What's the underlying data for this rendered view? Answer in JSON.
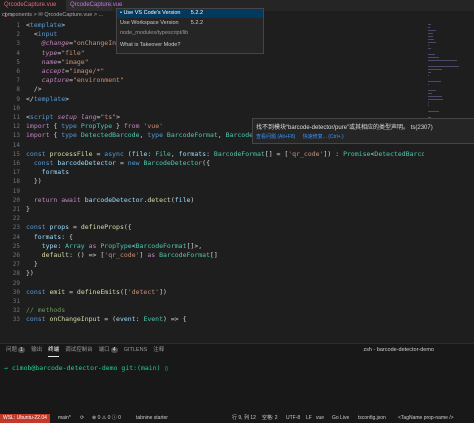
{
  "tabs": [
    {
      "label": "QrcodeCapture.vue 1",
      "close": "×"
    },
    {
      "label": "QrcodeCapture.vue"
    }
  ],
  "breadcrumb": "components > ✉ QrcodeCapture.vue > ...",
  "dropdown": {
    "items": [
      {
        "label": "• Use VS Code's Version",
        "version": "5.2.2"
      },
      {
        "label": "Use Workspace Version",
        "version": "5.2.2"
      },
      {
        "label": "node_modules/typescript/lib",
        "version": ""
      },
      {
        "label": "What is Takeover Mode?",
        "version": ""
      }
    ]
  },
  "code": [
    {
      "n": "1",
      "segs": [
        [
          "p",
          "<"
        ],
        [
          "tag",
          "template"
        ],
        [
          "p",
          ">"
        ]
      ]
    },
    {
      "n": "2",
      "segs": [
        [
          "p",
          "  <"
        ],
        [
          "tag",
          "input"
        ]
      ]
    },
    {
      "n": "3",
      "segs": [
        [
          "p",
          "    "
        ],
        [
          "attr",
          "@change"
        ],
        [
          "p",
          "="
        ],
        [
          "s",
          "\"onChangeInput\""
        ]
      ]
    },
    {
      "n": "4",
      "segs": [
        [
          "p",
          "    "
        ],
        [
          "attr",
          "type"
        ],
        [
          "p",
          "="
        ],
        [
          "s",
          "\"file\""
        ]
      ]
    },
    {
      "n": "5",
      "segs": [
        [
          "p",
          "    "
        ],
        [
          "attr",
          "name"
        ],
        [
          "p",
          "="
        ],
        [
          "s",
          "\"image\""
        ]
      ]
    },
    {
      "n": "6",
      "segs": [
        [
          "p",
          "    "
        ],
        [
          "attr",
          "accept"
        ],
        [
          "p",
          "="
        ],
        [
          "s",
          "\"image/*\""
        ]
      ]
    },
    {
      "n": "7",
      "segs": [
        [
          "p",
          "    "
        ],
        [
          "attr",
          "capture"
        ],
        [
          "p",
          "="
        ],
        [
          "s",
          "\"environment\""
        ]
      ]
    },
    {
      "n": "8",
      "segs": [
        [
          "p",
          "  />"
        ]
      ]
    },
    {
      "n": "9",
      "segs": [
        [
          "p",
          "</"
        ],
        [
          "tag",
          "template"
        ],
        [
          "p",
          ">"
        ]
      ]
    },
    {
      "n": "10",
      "segs": [
        [
          "p",
          ""
        ]
      ]
    },
    {
      "n": "11",
      "segs": [
        [
          "p",
          "<"
        ],
        [
          "tag",
          "script"
        ],
        [
          "p",
          " "
        ],
        [
          "attr",
          "setup"
        ],
        [
          "p",
          " "
        ],
        [
          "attr",
          "lang"
        ],
        [
          "p",
          "="
        ],
        [
          "s",
          "\"ts\""
        ],
        [
          "p",
          ">"
        ]
      ]
    },
    {
      "n": "12",
      "segs": [
        [
          "kw",
          "import"
        ],
        [
          "p",
          " { "
        ],
        [
          "k",
          "type"
        ],
        [
          "p",
          " "
        ],
        [
          "t",
          "PropType"
        ],
        [
          "p",
          " } "
        ],
        [
          "kw",
          "from"
        ],
        [
          "p",
          " "
        ],
        [
          "s",
          "'vue'"
        ]
      ]
    },
    {
      "n": "13",
      "segs": [
        [
          "kw",
          "import"
        ],
        [
          "p",
          " { "
        ],
        [
          "k",
          "type"
        ],
        [
          "p",
          " "
        ],
        [
          "t",
          "DetectedBarcode"
        ],
        [
          "p",
          ", "
        ],
        [
          "k",
          "type"
        ],
        [
          "p",
          " "
        ],
        [
          "t",
          "BarcodeFormat"
        ],
        [
          "p",
          ", "
        ],
        [
          "t",
          "BarcodeDetector"
        ],
        [
          "p",
          " } "
        ],
        [
          "kw",
          "from"
        ],
        [
          "p",
          " "
        ],
        [
          "s",
          "'barcode-detector/pure'"
        ]
      ]
    },
    {
      "n": "14",
      "segs": [
        [
          "p",
          ""
        ]
      ]
    },
    {
      "n": "15",
      "segs": [
        [
          "k",
          "const"
        ],
        [
          "p",
          " "
        ],
        [
          "f",
          "processFile"
        ],
        [
          "p",
          " = "
        ],
        [
          "k",
          "async"
        ],
        [
          "p",
          " ("
        ],
        [
          "v",
          "file"
        ],
        [
          "p",
          ": "
        ],
        [
          "t",
          "File"
        ],
        [
          "p",
          ", "
        ],
        [
          "v",
          "formats"
        ],
        [
          "p",
          ": "
        ],
        [
          "t",
          "BarcodeFormat"
        ],
        [
          "p",
          "[] = ["
        ],
        [
          "s",
          "'qr_code'"
        ],
        [
          "p",
          "]) : "
        ],
        [
          "t",
          "Promise"
        ],
        [
          "p",
          "<"
        ],
        [
          "t",
          "DetectedBarcode"
        ]
      ]
    },
    {
      "n": "16",
      "segs": [
        [
          "p",
          "  "
        ],
        [
          "k",
          "const"
        ],
        [
          "p",
          " "
        ],
        [
          "v",
          "barcodeDetector"
        ],
        [
          "p",
          " = "
        ],
        [
          "k",
          "new"
        ],
        [
          "p",
          " "
        ],
        [
          "t",
          "BarcodeDetector"
        ],
        [
          "p",
          "({"
        ]
      ]
    },
    {
      "n": "17",
      "segs": [
        [
          "p",
          "    "
        ],
        [
          "v",
          "formats"
        ]
      ]
    },
    {
      "n": "18",
      "segs": [
        [
          "p",
          "  })"
        ]
      ]
    },
    {
      "n": "19",
      "segs": [
        [
          "p",
          ""
        ]
      ]
    },
    {
      "n": "20",
      "segs": [
        [
          "p",
          "  "
        ],
        [
          "kw",
          "return"
        ],
        [
          "p",
          " "
        ],
        [
          "kw",
          "await"
        ],
        [
          "p",
          " "
        ],
        [
          "v",
          "barcodeDetector"
        ],
        [
          "p",
          "."
        ],
        [
          "f",
          "detect"
        ],
        [
          "p",
          "("
        ],
        [
          "v",
          "file"
        ],
        [
          "p",
          ")"
        ]
      ]
    },
    {
      "n": "21",
      "segs": [
        [
          "p",
          "}"
        ]
      ]
    },
    {
      "n": "22",
      "segs": [
        [
          "p",
          ""
        ]
      ]
    },
    {
      "n": "23",
      "segs": [
        [
          "k",
          "const"
        ],
        [
          "p",
          " "
        ],
        [
          "v",
          "props"
        ],
        [
          "p",
          " = "
        ],
        [
          "f",
          "defineProps"
        ],
        [
          "p",
          "({"
        ]
      ]
    },
    {
      "n": "24",
      "segs": [
        [
          "p",
          "  "
        ],
        [
          "v",
          "formats"
        ],
        [
          "p",
          ": {"
        ]
      ]
    },
    {
      "n": "25",
      "segs": [
        [
          "p",
          "    "
        ],
        [
          "v",
          "type"
        ],
        [
          "p",
          ": "
        ],
        [
          "t",
          "Array"
        ],
        [
          "p",
          " "
        ],
        [
          "kw",
          "as"
        ],
        [
          "p",
          " "
        ],
        [
          "t",
          "PropType"
        ],
        [
          "p",
          "<"
        ],
        [
          "t",
          "BarcodeFormat"
        ],
        [
          "p",
          "[]>,"
        ]
      ]
    },
    {
      "n": "26",
      "segs": [
        [
          "p",
          "    "
        ],
        [
          "f",
          "default"
        ],
        [
          "p",
          ": () => ["
        ],
        [
          "s",
          "'qr_code'"
        ],
        [
          "p",
          "] "
        ],
        [
          "kw",
          "as"
        ],
        [
          "p",
          " "
        ],
        [
          "t",
          "BarcodeFormat"
        ],
        [
          "p",
          "[]"
        ]
      ]
    },
    {
      "n": "27",
      "segs": [
        [
          "p",
          "  }"
        ]
      ]
    },
    {
      "n": "28",
      "segs": [
        [
          "p",
          "})"
        ]
      ]
    },
    {
      "n": "29",
      "segs": [
        [
          "p",
          ""
        ]
      ]
    },
    {
      "n": "30",
      "segs": [
        [
          "k",
          "const"
        ],
        [
          "p",
          " "
        ],
        [
          "f",
          "emit"
        ],
        [
          "p",
          " = "
        ],
        [
          "f",
          "defineEmits"
        ],
        [
          "p",
          "(["
        ],
        [
          "s",
          "'detect'"
        ],
        [
          "p",
          "])"
        ]
      ]
    },
    {
      "n": "31",
      "segs": [
        [
          "p",
          ""
        ]
      ]
    },
    {
      "n": "32",
      "segs": [
        [
          "c",
          "// methods"
        ]
      ]
    },
    {
      "n": "33",
      "segs": [
        [
          "k",
          "const"
        ],
        [
          "p",
          " "
        ],
        [
          "f",
          "onChangeInput"
        ],
        [
          "p",
          " = ("
        ],
        [
          "v",
          "event"
        ],
        [
          "p",
          ": "
        ],
        [
          "t",
          "Event"
        ],
        [
          "p",
          ") => {"
        ]
      ]
    }
  ],
  "hover": {
    "message": "找不到模块“barcode-detector/pure”或其相应的类型声明。 ts(2307)",
    "actions": [
      "查看问题 (Alt+F8)",
      "快速修复... (Ctrl+.)"
    ]
  },
  "panel": {
    "tabs": [
      {
        "label": "问题",
        "badge": "1"
      },
      {
        "label": "输出"
      },
      {
        "label": "终端",
        "active": true
      },
      {
        "label": "调试控制台"
      },
      {
        "label": "端口",
        "badge": "4"
      },
      {
        "label": "GITLENS"
      },
      {
        "label": "注释"
      }
    ],
    "terminal_title": "zsh - barcode-detector-demo",
    "prompt": "→ cimob@barcode-detector-demo git:(main) ▯"
  },
  "status": {
    "remote": "WSL: Ubuntu-22.04",
    "branch": "main*",
    "sync": "⟳",
    "errors": "⊗ 0 ⚠ 0 ⓘ 0",
    "position": "行 9, 列 12",
    "spaces": "空格: 2",
    "encoding": "UTF-8",
    "eol": "LF",
    "lang": "vue",
    "golive": "Go Live",
    "tsconfig": "tsconfig.json",
    "tag": "<TagName prop-name />",
    "misc": "tabnine starter"
  }
}
